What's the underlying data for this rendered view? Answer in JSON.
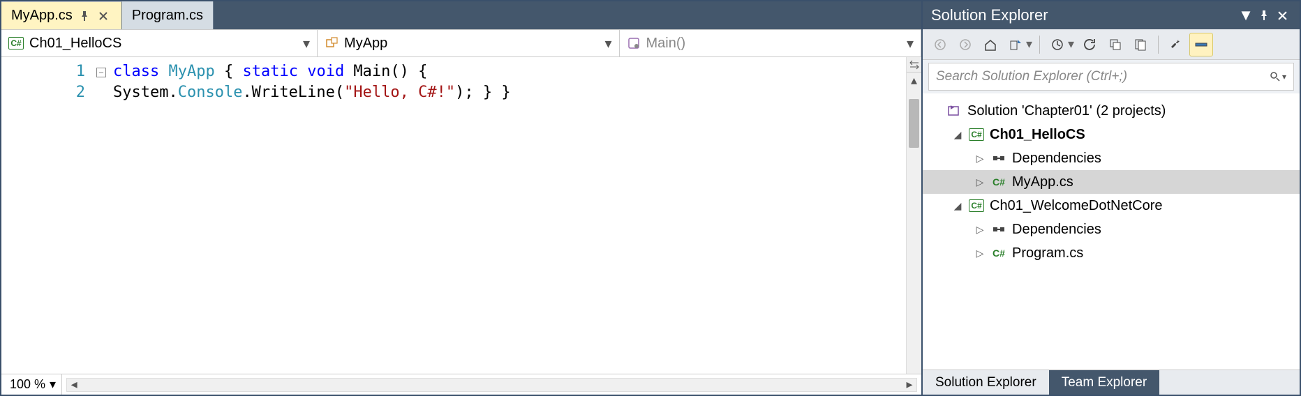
{
  "tabs": [
    {
      "label": "MyApp.cs",
      "active": true,
      "pinned": true
    },
    {
      "label": "Program.cs",
      "active": false,
      "pinned": false
    }
  ],
  "nav": {
    "scope": "Ch01_HelloCS",
    "class": "MyApp",
    "member": "Main()"
  },
  "code": {
    "lines": [
      {
        "num": "1",
        "tokens": [
          {
            "t": "kw",
            "v": "class"
          },
          {
            "t": "plain",
            "v": " "
          },
          {
            "t": "type",
            "v": "MyApp"
          },
          {
            "t": "plain",
            "v": " { "
          },
          {
            "t": "kw",
            "v": "static"
          },
          {
            "t": "plain",
            "v": " "
          },
          {
            "t": "kw",
            "v": "void"
          },
          {
            "t": "plain",
            "v": " Main() {"
          }
        ]
      },
      {
        "num": "2",
        "tokens": [
          {
            "t": "plain",
            "v": "System."
          },
          {
            "t": "type",
            "v": "Console"
          },
          {
            "t": "plain",
            "v": ".WriteLine("
          },
          {
            "t": "str",
            "v": "\"Hello, C#!\""
          },
          {
            "t": "plain",
            "v": "); } }"
          }
        ]
      }
    ]
  },
  "zoom": "100 %",
  "solution_explorer": {
    "title": "Solution Explorer",
    "search_placeholder": "Search Solution Explorer (Ctrl+;)",
    "root": "Solution 'Chapter01' (2 projects)",
    "projects": [
      {
        "name": "Ch01_HelloCS",
        "bold": true,
        "children": [
          {
            "name": "Dependencies",
            "type": "dep"
          },
          {
            "name": "MyApp.cs",
            "type": "cs",
            "selected": true
          }
        ]
      },
      {
        "name": "Ch01_WelcomeDotNetCore",
        "bold": false,
        "children": [
          {
            "name": "Dependencies",
            "type": "dep"
          },
          {
            "name": "Program.cs",
            "type": "cs"
          }
        ]
      }
    ],
    "bottom_tabs": {
      "active": "Solution Explorer",
      "other": "Team Explorer"
    }
  }
}
